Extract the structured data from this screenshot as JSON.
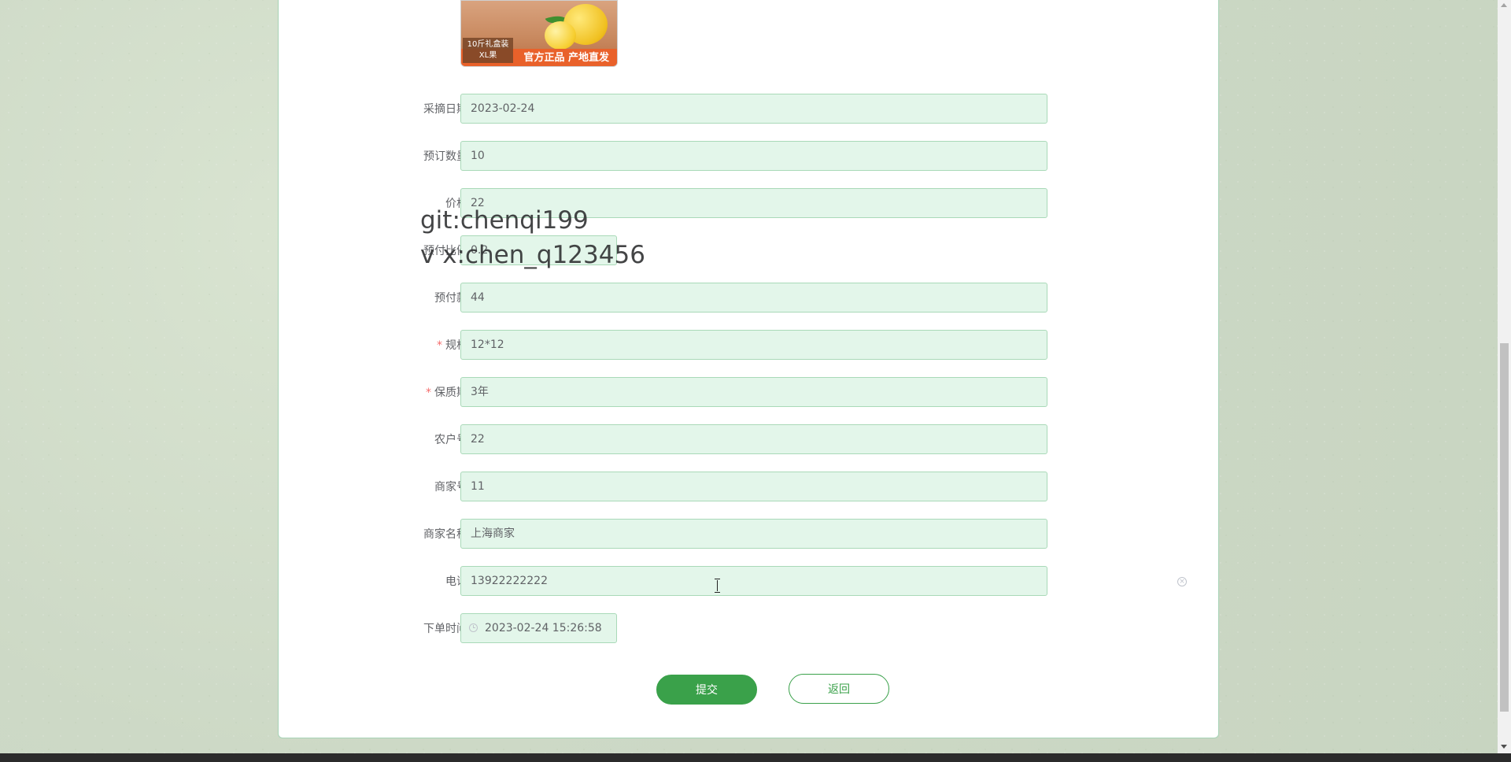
{
  "product_image": {
    "banner": "官方正品 产地直发",
    "side_line1": "10斤礼盒装",
    "side_line2": "XL果"
  },
  "fields": [
    {
      "label": "采摘日期",
      "value": "2023-02-24",
      "required": false
    },
    {
      "label": "预订数量",
      "value": "10",
      "required": false
    },
    {
      "label": "价格",
      "value": "22",
      "required": false
    },
    {
      "label": "预付比例",
      "value": "0.2",
      "required": false
    },
    {
      "label": "预付款",
      "value": "44",
      "required": false
    },
    {
      "label": "规格",
      "value": "12*12",
      "required": true
    },
    {
      "label": "保质期",
      "value": "3年",
      "required": true
    },
    {
      "label": "农户号",
      "value": "22",
      "required": false
    },
    {
      "label": "商家号",
      "value": "11",
      "required": false
    },
    {
      "label": "商家名称",
      "value": "上海商家",
      "required": false
    },
    {
      "label": "电话",
      "value": "13922222222",
      "required": false
    },
    {
      "label": "下单时间",
      "value": "2023-02-24 15:26:58",
      "required": false
    }
  ],
  "watermark": {
    "line1": "git:chenqi199",
    "line2": "v x:chen_q123456"
  },
  "buttons": {
    "submit": "提交",
    "back": "返回"
  },
  "required_mark": "*",
  "colors": {
    "accent": "#3aa14a",
    "input_bg": "#e3f6ea",
    "input_border": "#a9d9b8",
    "required": "#f56c6c"
  },
  "icons": {
    "date": "clock-icon",
    "clear": "circle-close-icon"
  }
}
